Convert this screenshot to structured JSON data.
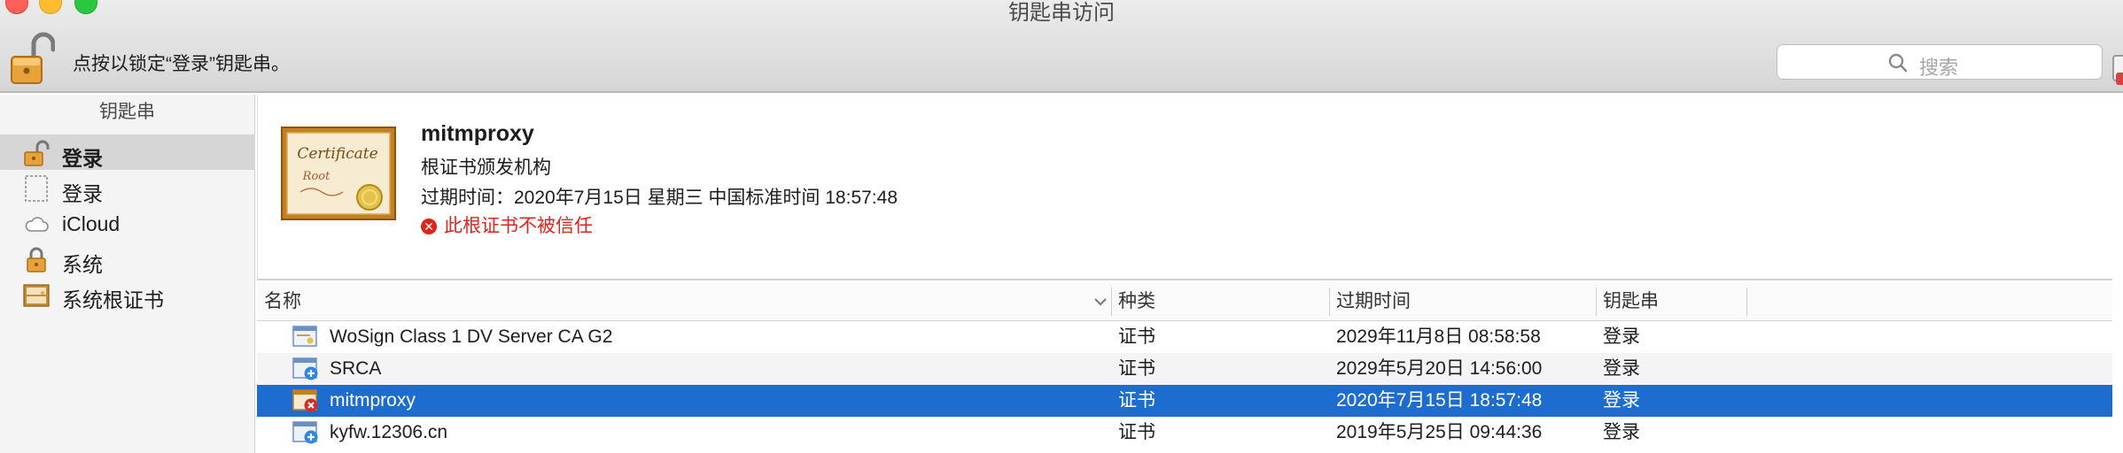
{
  "window": {
    "title": "钥匙串访问"
  },
  "toolbar": {
    "lock_text": "点按以锁定“登录”钥匙串。"
  },
  "search": {
    "placeholder": "搜索"
  },
  "sidebar": {
    "header": "钥匙串",
    "items": [
      {
        "label": "登录",
        "icon": "unlocked-padlock-icon",
        "selected": true
      },
      {
        "label": "登录",
        "icon": "empty-keychain-icon",
        "selected": false
      },
      {
        "label": "iCloud",
        "icon": "cloud-icon",
        "selected": false
      },
      {
        "label": "系统",
        "icon": "locked-padlock-icon",
        "selected": false
      },
      {
        "label": "系统根证书",
        "icon": "certificate-cabinet-icon",
        "selected": false
      }
    ]
  },
  "detail": {
    "name": "mitmproxy",
    "type": "根证书颁发机构",
    "expiry": "过期时间：2020年7月15日 星期三 中国标准时间 18:57:48",
    "warning": "此根证书不被信任",
    "art_text_1": "Certificate",
    "art_text_2": "Root"
  },
  "table": {
    "columns": [
      "名称",
      "种类",
      "过期时间",
      "钥匙串"
    ],
    "rows": [
      {
        "name": "WoSign Class 1 DV Server CA G2",
        "kind": "证书",
        "expires": "2029年11月8日 08:58:58",
        "keychain": "登录",
        "icon": "certificate-icon"
      },
      {
        "name": "SRCA",
        "kind": "证书",
        "expires": "2029年5月20日 14:56:00",
        "keychain": "登录",
        "icon": "certificate-plus-icon"
      },
      {
        "name": "mitmproxy",
        "kind": "证书",
        "expires": "2020年7月15日 18:57:48",
        "keychain": "登录",
        "icon": "certificate-untrusted-icon",
        "selected": true
      },
      {
        "name": "kyfw.12306.cn",
        "kind": "证书",
        "expires": "2019年5月25日 09:44:36",
        "keychain": "登录",
        "icon": "certificate-plus-icon"
      }
    ]
  },
  "colors": {
    "selection": "#1d6dd1",
    "warning": "#e0241b"
  }
}
